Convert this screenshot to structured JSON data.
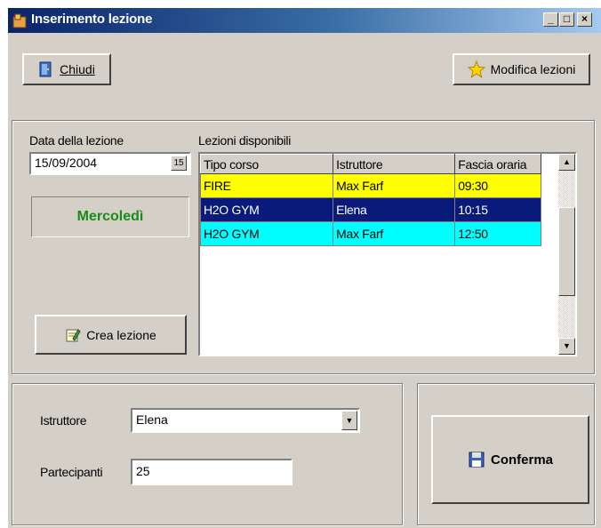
{
  "window": {
    "title": "Inserimento lezione",
    "controls": [
      "_",
      "□",
      "×"
    ]
  },
  "toolbar": {
    "close_label": "Chiudi",
    "modify_label": "Modifica lezioni"
  },
  "date_section": {
    "label": "Data della lezione",
    "value": "15/09/2004",
    "picker_label": "15",
    "weekday": "Mercoledì"
  },
  "create_button": {
    "label": "Crea lezione"
  },
  "lessons": {
    "label": "Lezioni disponibili",
    "columns": [
      "Tipo corso",
      "Istruttore",
      "Fascia oraria"
    ],
    "rows": [
      {
        "tipo": "FIRE",
        "istruttore": "Max Farf",
        "fascia": "09:30",
        "bg": "#ffff00",
        "fg": "#000000"
      },
      {
        "tipo": "H2O GYM",
        "istruttore": "Elena",
        "fascia": "10:15",
        "bg": "#0a1a7a",
        "fg": "#ffffff"
      },
      {
        "tipo": "H2O GYM",
        "istruttore": "Max Farf",
        "fascia": "12:50",
        "bg": "#00ffff",
        "fg": "#000000"
      }
    ]
  },
  "form": {
    "instructor_label": "Istruttore",
    "instructor_value": "Elena",
    "participants_label": "Partecipanti",
    "participants_value": "25"
  },
  "confirm": {
    "label": "Conferma"
  }
}
